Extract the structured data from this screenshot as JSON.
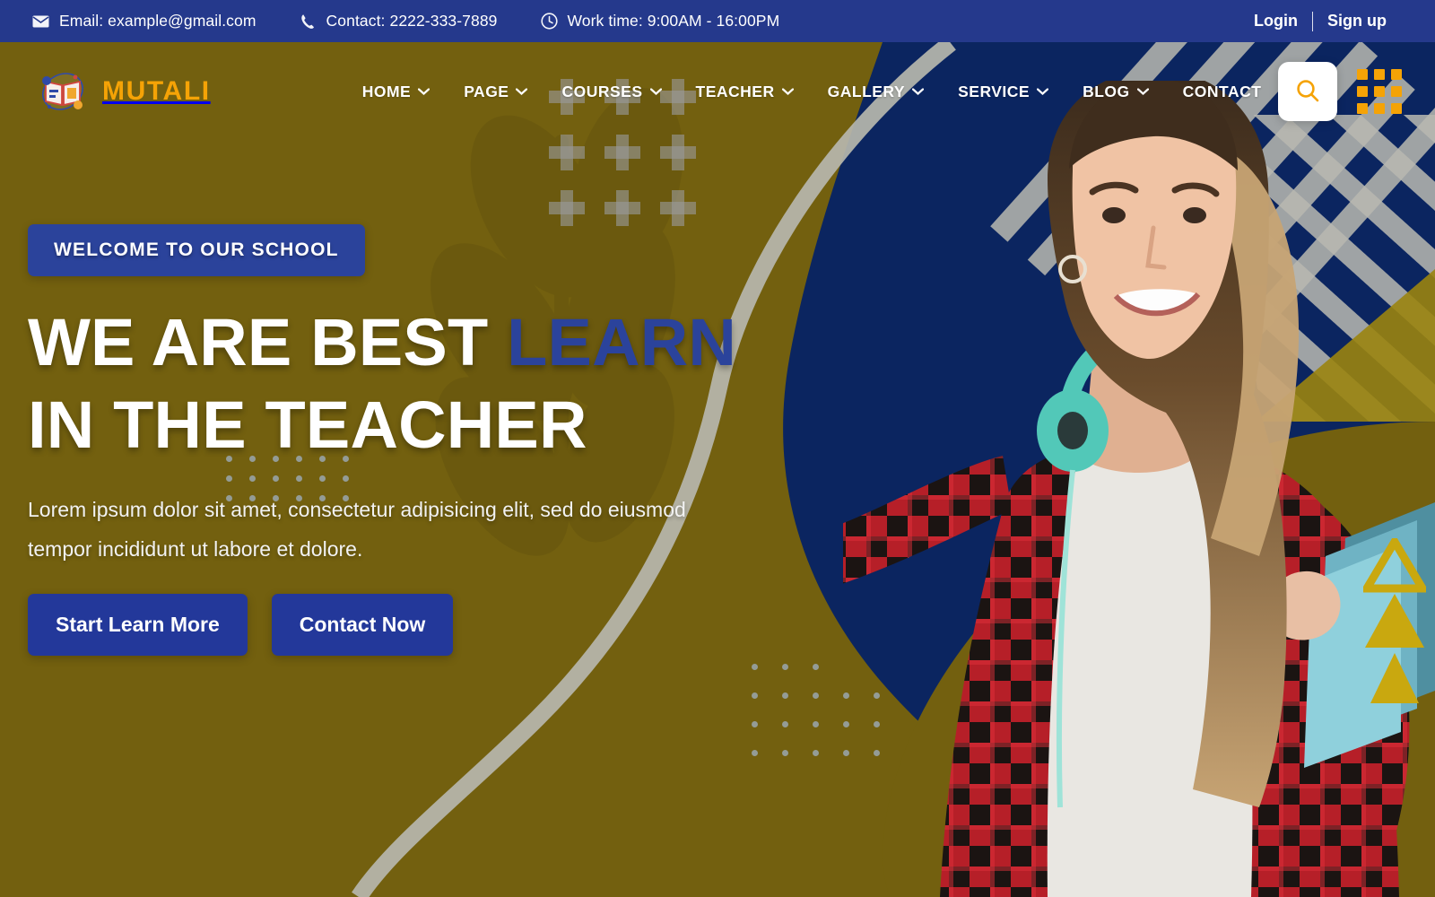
{
  "theme": {
    "navy": "#0b2560",
    "navy_bar": "#25398c",
    "button_blue": "#23389a",
    "yellow": "#73600f",
    "accent_orange": "#f5a306",
    "stripe_gray": "#b8b8b0",
    "dot_gray": "#9fb0c4"
  },
  "topbar": {
    "email": "Email: example@gmail.com",
    "contact": "Contact: 2222-333-7889",
    "worktime": "Work time: 9:00AM - 16:00PM",
    "email_icon": "envelope-icon",
    "contact_icon": "phone-icon",
    "worktime_icon": "clock-icon",
    "login": "Login",
    "signup": "Sign up"
  },
  "brand": {
    "name": "MUTALI",
    "logo_icon": "open-book-icon"
  },
  "nav": {
    "items": [
      {
        "label": "HOME",
        "has_dropdown": true
      },
      {
        "label": "PAGE",
        "has_dropdown": true
      },
      {
        "label": "COURSES",
        "has_dropdown": true
      },
      {
        "label": "TEACHER",
        "has_dropdown": true
      },
      {
        "label": "GALLERY",
        "has_dropdown": true
      },
      {
        "label": "SERVICE",
        "has_dropdown": true
      },
      {
        "label": "BLOG",
        "has_dropdown": true
      },
      {
        "label": "CONTACT",
        "has_dropdown": false
      }
    ],
    "search_icon": "search-icon",
    "grid_menu_icon": "grid-menu-icon"
  },
  "hero": {
    "badge": "WELCOME TO OUR SCHOOL",
    "headline_line1_a": "WE ARE BEST ",
    "headline_line1_b": "LEARN",
    "headline_line2": "IN THE TEACHER",
    "lead": "Lorem ipsum dolor sit amet, consectetur adipisicing elit, sed do eiusmod tempor incididunt ut labore et dolore.",
    "cta_primary": "Start Learn More",
    "cta_secondary": "Contact Now"
  },
  "decor": {
    "plus_grid": "plus-shape-grid",
    "dot_grid_upper": "dot-grid-upper",
    "dot_grid_lower": "dot-grid-lower",
    "diagonal_stripes": "diagonal-stripes",
    "triangles": "triangle-stack",
    "wheat_watermark": "wheat-leaf-watermark",
    "photo": "student-with-headphones-photo"
  }
}
